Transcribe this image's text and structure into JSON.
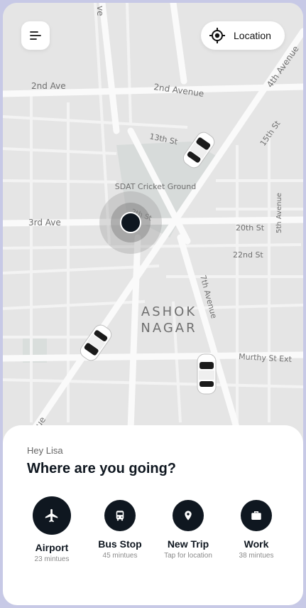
{
  "header": {
    "location_label": "Location",
    "menu_icon": "menu-icon",
    "location_icon": "crosshair-icon"
  },
  "map": {
    "streets": [
      "2nd Ave",
      "2nd Avenue",
      "4th Avenue",
      "13th St",
      "15th St",
      "3rd Ave",
      "2th St",
      "20th St",
      "22nd St",
      "5th Avenue",
      "7th Avenue",
      "Murthy St Ext",
      "ve",
      "ue"
    ],
    "place": "SDAT Cricket Ground",
    "area_line1": "ASHOK",
    "area_line2": "NAGAR"
  },
  "sheet": {
    "greeting": "Hey Lisa",
    "question": "Where are you going?",
    "actions": [
      {
        "title": "Airport",
        "sub": "23 mintues",
        "icon": "airplane-icon"
      },
      {
        "title": "Bus Stop",
        "sub": "45 mintues",
        "icon": "bus-icon"
      },
      {
        "title": "New Trip",
        "sub": "Tap for location",
        "icon": "location-pin-icon"
      },
      {
        "title": "Work",
        "sub": "38 mintues",
        "icon": "briefcase-icon"
      }
    ]
  },
  "colors": {
    "accent": "#0f1720",
    "map_bg": "#e6e6e6",
    "road": "#f6f6f6",
    "park": "#d8dcdb"
  }
}
